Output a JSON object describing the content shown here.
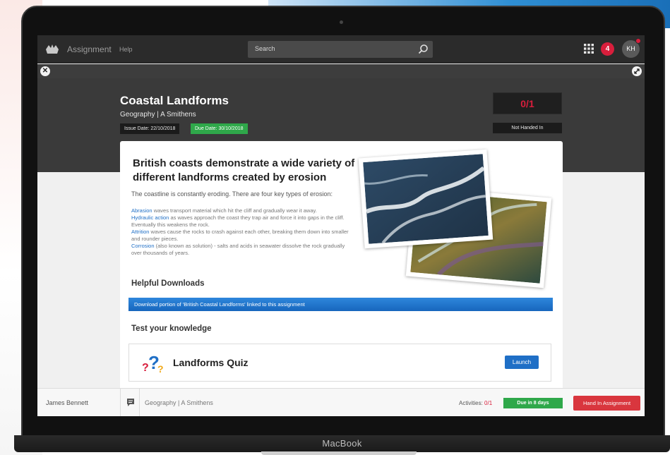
{
  "device": {
    "label": "MacBook"
  },
  "topbar": {
    "app_title": "Assignment",
    "help_label": "Help",
    "search_placeholder": "Search",
    "notification_count": "4",
    "avatar_initials": "KH"
  },
  "assignment": {
    "title": "Coastal Landforms",
    "subtitle": "Geography | A Smithens",
    "issue_date": "Issue Date: 22/10/2018",
    "due_date": "Due Date: 30/10/2018",
    "score": "0/1",
    "status": "Not Handed In"
  },
  "content": {
    "heading": "British coasts demonstrate a wide variety of different landforms created by erosion",
    "intro": "The coastline is constantly eroding. There are four key types of erosion:",
    "erosion_types": [
      {
        "term": "Abrasion",
        "text": " waves transport material which hit the cliff and gradually wear it away."
      },
      {
        "term": "Hydraulic action",
        "text": " as waves approach the coast they trap air and force it into gaps in the cliff. Eventually this weakens the rock."
      },
      {
        "term": "Attrition",
        "text": " waves cause the rocks to crash against each other, breaking them down into smaller and rounder pieces."
      },
      {
        "term": "Corrosion",
        "text": " (also known as solution) - salts and acids in seawater dissolve the rock gradually over thousands of years."
      }
    ],
    "downloads_heading": "Helpful Downloads",
    "download_link": "Download portion of 'British Coastal Landforms' linked to this assignment",
    "knowledge_heading": "Test your knowledge",
    "quiz_title": "Landforms Quiz",
    "launch_label": "Launch"
  },
  "footer": {
    "student_name": "James Bennett",
    "class_label": "Geography | A Smithens",
    "activities_label": "Activities:",
    "activities_count": "0/1",
    "due_in": "Due in 8 days",
    "hand_in_label": "Hand In Assignment"
  },
  "colors": {
    "accent_red": "#d81e3c",
    "accent_green": "#2fa84a",
    "link_blue": "#1f6fc6"
  }
}
